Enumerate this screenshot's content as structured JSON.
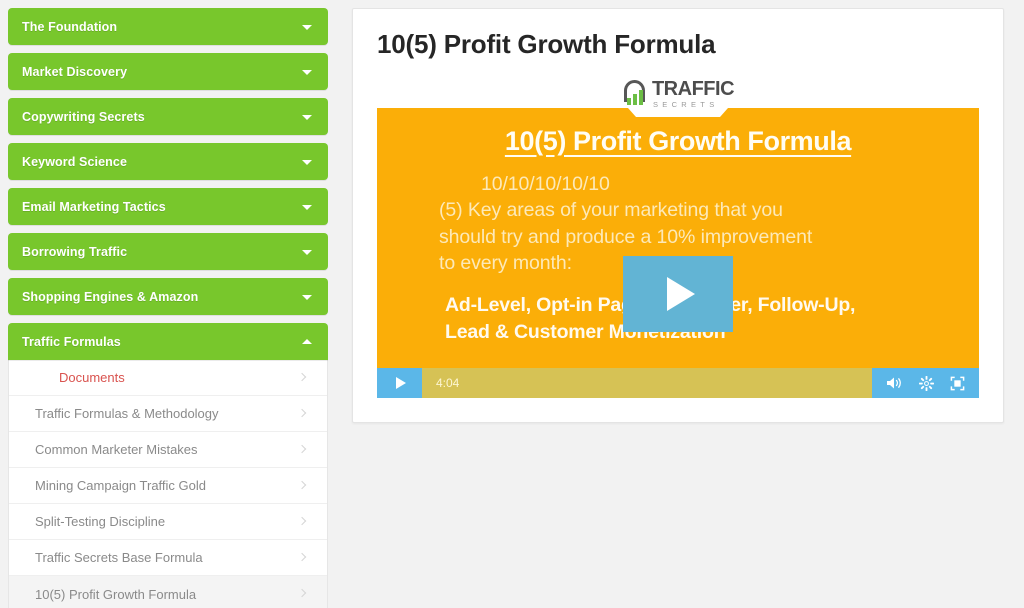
{
  "sidebar": {
    "sections": [
      {
        "label": "The Foundation",
        "open": false,
        "chevron": "chevron-down-icon"
      },
      {
        "label": "Market Discovery",
        "open": false,
        "chevron": "chevron-down-icon"
      },
      {
        "label": "Copywriting Secrets",
        "open": false,
        "chevron": "chevron-down-icon"
      },
      {
        "label": "Keyword Science",
        "open": false,
        "chevron": "chevron-down-icon"
      },
      {
        "label": "Email Marketing Tactics",
        "open": false,
        "chevron": "chevron-down-icon"
      },
      {
        "label": "Borrowing Traffic",
        "open": false,
        "chevron": "chevron-down-icon"
      },
      {
        "label": "Shopping Engines & Amazon",
        "open": false,
        "chevron": "chevron-down-icon"
      },
      {
        "label": "Traffic Formulas",
        "open": true,
        "chevron": "chevron-up-icon"
      }
    ],
    "submenu": [
      {
        "label": "Documents",
        "kind": "documents",
        "active": false
      },
      {
        "label": "Traffic Formulas & Methodology",
        "kind": "lesson",
        "active": false
      },
      {
        "label": "Common Marketer Mistakes",
        "kind": "lesson",
        "active": false
      },
      {
        "label": "Mining Campaign Traffic Gold",
        "kind": "lesson",
        "active": false
      },
      {
        "label": "Split-Testing Discipline",
        "kind": "lesson",
        "active": false
      },
      {
        "label": "Traffic Secrets Base Formula",
        "kind": "lesson",
        "active": false
      },
      {
        "label": "10(5) Profit Growth Formula",
        "kind": "lesson",
        "active": true
      }
    ]
  },
  "main": {
    "page_title": "10(5) Profit Growth Formula",
    "logo": {
      "main": "TRAFFIC",
      "sub": "SECRETS"
    },
    "video": {
      "slide_title": "10(5) Profit Growth Formula",
      "slide_line1": "10/10/10/10/10",
      "slide_line2": "(5) Key areas of your marketing that you",
      "slide_line3": "should try and produce a 10% improvement",
      "slide_line4": "to every month:",
      "slide_bold1": "Ad-Level, Opt-in Page, Core Offer, Follow-Up,",
      "slide_bold2": "Lead & Customer Monetization",
      "time": "4:04",
      "play_label": "play-button",
      "controls": {
        "volume": "volume-icon",
        "settings": "gear-icon",
        "fullscreen": "fullscreen-icon"
      }
    }
  },
  "colors": {
    "accent_green": "#78c72c",
    "slide_orange": "#FBAE08",
    "control_blue": "#5bb7e8",
    "control_bar": "#d6c255",
    "documents_red": "#d9534f"
  }
}
